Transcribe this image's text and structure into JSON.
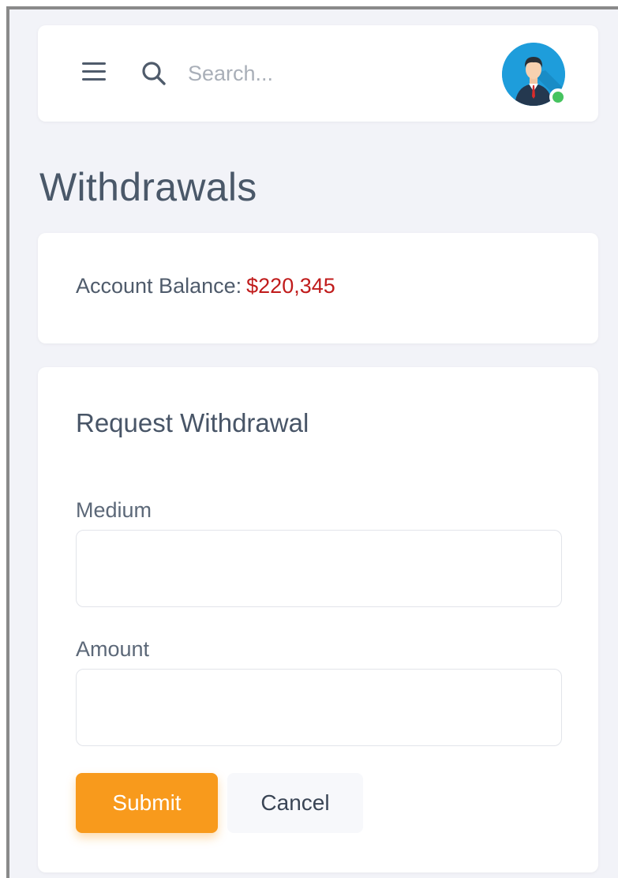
{
  "header": {
    "search_placeholder": "Search...",
    "menu_icon": "hamburger-menu-icon",
    "search_icon": "search-icon",
    "avatar_icon": "user-avatar",
    "status": "online"
  },
  "page": {
    "title": "Withdrawals"
  },
  "balance": {
    "label": "Account Balance:",
    "value": "$220,345"
  },
  "form": {
    "title": "Request Withdrawal",
    "fields": [
      {
        "label": "Medium",
        "value": ""
      },
      {
        "label": "Amount",
        "value": ""
      }
    ],
    "submit_label": "Submit",
    "cancel_label": "Cancel"
  },
  "colors": {
    "accent": "#f89a1c",
    "balance_value": "#c01b1b",
    "background": "#f2f3f8",
    "avatar_bg": "#1e9ddb",
    "status_online": "#46c35f"
  }
}
